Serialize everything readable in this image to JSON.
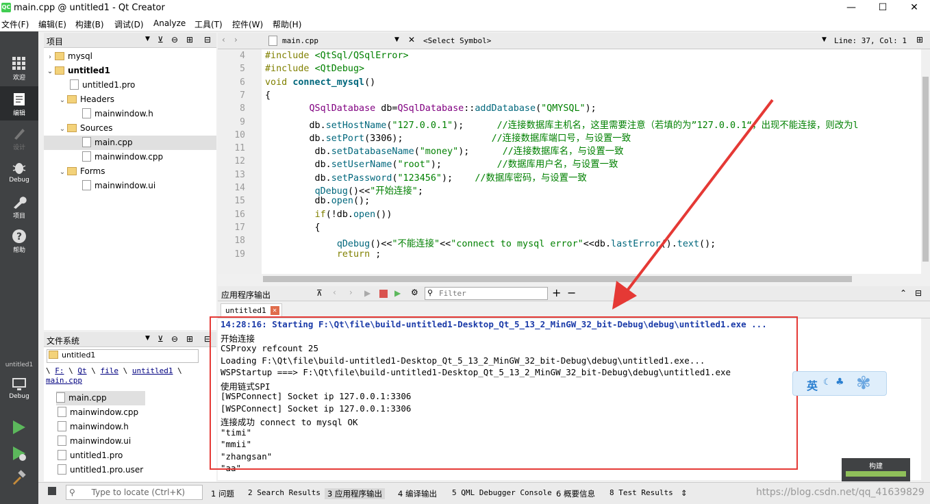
{
  "window": {
    "title": "main.cpp @ untitled1 - Qt Creator",
    "app_icon": "QC",
    "min": "—",
    "max": "☐",
    "close": "✕"
  },
  "menu": [
    "文件(F)",
    "编辑(E)",
    "构建(B)",
    "调试(D)",
    "Analyze",
    "工具(T)",
    "控件(W)",
    "帮助(H)"
  ],
  "modes": [
    {
      "label": "欢迎",
      "icon": "grid-icon"
    },
    {
      "label": "编辑",
      "icon": "edit-icon"
    },
    {
      "label": "设计",
      "icon": "design-icon"
    },
    {
      "label": "Debug",
      "icon": "bug-icon"
    },
    {
      "label": "项目",
      "icon": "wrench-icon"
    },
    {
      "label": "帮助",
      "icon": "help-icon"
    }
  ],
  "kit": {
    "project": "untitled1",
    "config": "Debug"
  },
  "projects_panel": {
    "title": "项目",
    "tree": [
      {
        "label": "mysql",
        "type": "project",
        "level": 0,
        "arrow": "›"
      },
      {
        "label": "untitled1",
        "type": "project",
        "level": 0,
        "arrow": "⌄",
        "bold": true
      },
      {
        "label": "untitled1.pro",
        "type": "pro",
        "level": 1
      },
      {
        "label": "Headers",
        "type": "folder",
        "level": 1,
        "arrow": "⌄"
      },
      {
        "label": "mainwindow.h",
        "type": "h",
        "level": 2
      },
      {
        "label": "Sources",
        "type": "folder",
        "level": 1,
        "arrow": "⌄"
      },
      {
        "label": "main.cpp",
        "type": "cpp",
        "level": 2,
        "selected": true
      },
      {
        "label": "mainwindow.cpp",
        "type": "cpp",
        "level": 2
      },
      {
        "label": "Forms",
        "type": "folder",
        "level": 1,
        "arrow": "⌄"
      },
      {
        "label": "mainwindow.ui",
        "type": "ui",
        "level": 2
      }
    ]
  },
  "fs_panel": {
    "title": "文件系统",
    "combo": "untitled1",
    "breadcrumb": [
      "\\",
      "F:",
      "\\",
      "Qt",
      "\\",
      "file",
      "\\",
      "untitled1",
      "\\",
      "main.cpp"
    ],
    "files": [
      "main.cpp",
      "mainwindow.cpp",
      "mainwindow.h",
      "mainwindow.ui",
      "untitled1.pro",
      "untitled1.pro.user"
    ]
  },
  "editor": {
    "filename": "main.cpp",
    "symbol": "<Select Symbol>",
    "position": "Line: 37, Col: 1",
    "lines": [
      {
        "n": "4",
        "html": "<span class='kw'>#include</span> <span class='str'>&lt;QtSql/QSqlError&gt;</span>"
      },
      {
        "n": "5",
        "html": "<span class='kw'>#include</span> <span class='str'>&lt;QtDebug&gt;</span>"
      },
      {
        "n": "6",
        "html": "<span class='kw'>void</span> <span class='fn'><b>connect_mysql</b></span>()"
      },
      {
        "n": "7",
        "html": "{"
      },
      {
        "n": "8",
        "html": "        <span class='ty'>QSqlDatabase</span> db=<span class='ty'>QSqlDatabase</span>::<span class='fn'>addDatabase</span>(<span class='str'>\"QMYSQL\"</span>);"
      },
      {
        "n": "9",
        "html": "        db.<span class='fn'>setHostName</span>(<span class='str'>\"127.0.0.1\"</span>);      <span class='cm'>//连接数据库主机名，这里需要注意（若填的为”127.0.0.1“，出现不能连接，则改为l</span>"
      },
      {
        "n": "10",
        "html": "        db.<span class='fn'>setPort</span>(3306);                <span class='cm'>//连接数据库端口号，与设置一致</span>"
      },
      {
        "n": "11",
        "html": "         db.<span class='fn'>setDatabaseName</span>(<span class='str'>\"money\"</span>);      <span class='cm'>//连接数据库名，与设置一致</span>"
      },
      {
        "n": "12",
        "html": "         db.<span class='fn'>setUserName</span>(<span class='str'>\"root\"</span>);          <span class='cm'>//数据库用户名，与设置一致</span>"
      },
      {
        "n": "13",
        "html": "         db.<span class='fn'>setPassword</span>(<span class='str'>\"123456\"</span>);    <span class='cm'>//数据库密码，与设置一致</span>"
      },
      {
        "n": "14",
        "html": "         <span class='fn'>qDebug</span>()&lt;&lt;<span class='str'>\"开始连接\"</span>;"
      },
      {
        "n": "15",
        "html": "         db.<span class='fn'>open</span>();"
      },
      {
        "n": "16",
        "html": "         <span class='kw'>if</span>(!db.<span class='fn'>open</span>())"
      },
      {
        "n": "17",
        "html": "         {"
      },
      {
        "n": "18",
        "html": "             <span class='fn'>qDebug</span>()&lt;&lt;<span class='str'>\"不能连接\"</span>&lt;&lt;<span class='str'>\"connect to mysql error\"</span>&lt;&lt;db.<span class='fn'>lastError</span>().<span class='fn'>text</span>();"
      },
      {
        "n": "19",
        "html": "             <span class='kw'>return</span> ;"
      }
    ]
  },
  "output": {
    "title": "应用程序输出",
    "filter_placeholder": "Filter",
    "tab": "untitled1",
    "lines": [
      {
        "text": "14:28:16: Starting F:\\Qt\\file\\build-untitled1-Desktop_Qt_5_13_2_MinGW_32_bit-Debug\\debug\\untitled1.exe ...",
        "blue": true
      },
      {
        "text": "开始连接"
      },
      {
        "text": "CSProxy refcount 25"
      },
      {
        "text": "Loading F:\\Qt\\file\\build-untitled1-Desktop_Qt_5_13_2_MinGW_32_bit-Debug\\debug\\untitled1.exe..."
      },
      {
        "text": "WSPStartup ===> F:\\Qt\\file\\build-untitled1-Desktop_Qt_5_13_2_MinGW_32_bit-Debug\\debug\\untitled1.exe"
      },
      {
        "text": "使用链式SPI"
      },
      {
        "text": "[WSPConnect] Socket ip 127.0.0.1:3306"
      },
      {
        "text": "[WSPConnect] Socket ip 127.0.0.1:3306"
      },
      {
        "text": "连接成功 connect to mysql OK"
      },
      {
        "text": "\"timi\""
      },
      {
        "text": "\"mmii\""
      },
      {
        "text": "\"zhangsan\""
      },
      {
        "text": "\"aa\""
      }
    ]
  },
  "statusbar": {
    "locate_placeholder": "Type to locate (Ctrl+K)",
    "tabs": [
      "1 问题",
      "2 Search Results",
      "3 应用程序输出",
      "4 编译输出",
      "5 QML Debugger Console",
      "6 概要信息",
      "8 Test Results"
    ],
    "watermark": "https://blog.csdn.net/qq_41639829"
  },
  "build_widget": {
    "label": "构建",
    "progress": 1.0
  },
  "ime": {
    "label": "英"
  },
  "colors": {
    "annotation": "#e53935",
    "accent_green": "#41cd52"
  }
}
